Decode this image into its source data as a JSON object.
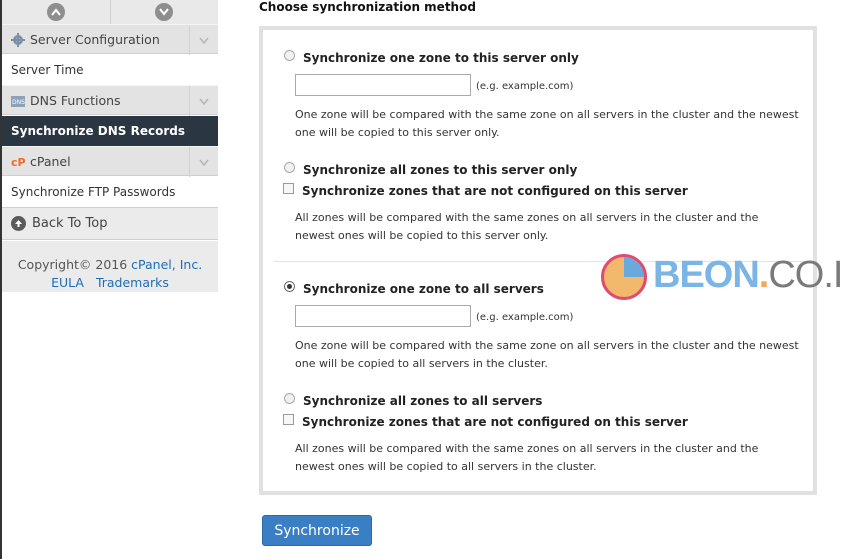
{
  "sidebar": {
    "groups": [
      {
        "label": "Server Configuration",
        "icon": "gear-icon"
      },
      {
        "label": "DNS Functions",
        "icon": "dns-icon"
      },
      {
        "label": "cPanel",
        "icon": "cpanel-icon"
      }
    ],
    "items": [
      {
        "label": "Server Time"
      },
      {
        "label": "Synchronize DNS Records",
        "active": true
      },
      {
        "label": "Synchronize FTP Passwords"
      }
    ],
    "back_to_top": "Back To Top",
    "copyright": "Copyright© 2016",
    "copyright_link": "cPanel, Inc.",
    "eula": "EULA",
    "trademarks": "Trademarks"
  },
  "main": {
    "title": "Choose synchronization method",
    "options": [
      {
        "label": "Synchronize one zone to this server only",
        "checked": false
      },
      {
        "label": "Synchronize all zones to this server only",
        "checked": false
      },
      {
        "label": "Synchronize one zone to all servers",
        "checked": true
      },
      {
        "label": "Synchronize all zones to all servers",
        "checked": false
      }
    ],
    "unconfigured_label": "Synchronize zones that are not configured on this server",
    "hint": "(e.g. example.com)",
    "input_value": "",
    "descriptions": [
      "One zone will be compared with the same zone on all servers in the cluster and the newest one will be copied to this server only.",
      "All zones will be compared with the same zones on all servers in the cluster and the newest ones will be copied to this server only.",
      "One zone will be compared with the same zone on all servers in the cluster and the newest one will be copied to all servers in the cluster.",
      "All zones will be compared with the same zones on all servers in the cluster and the newest ones will be copied to all servers in the cluster."
    ],
    "submit_label": "Synchronize"
  },
  "watermark": {
    "brand": "BEON",
    "dot": ".",
    "tld": "CO.ID"
  },
  "colors": {
    "accent": "#3a7fc4",
    "active_nav": "#2a3642",
    "link": "#1e6db3"
  }
}
